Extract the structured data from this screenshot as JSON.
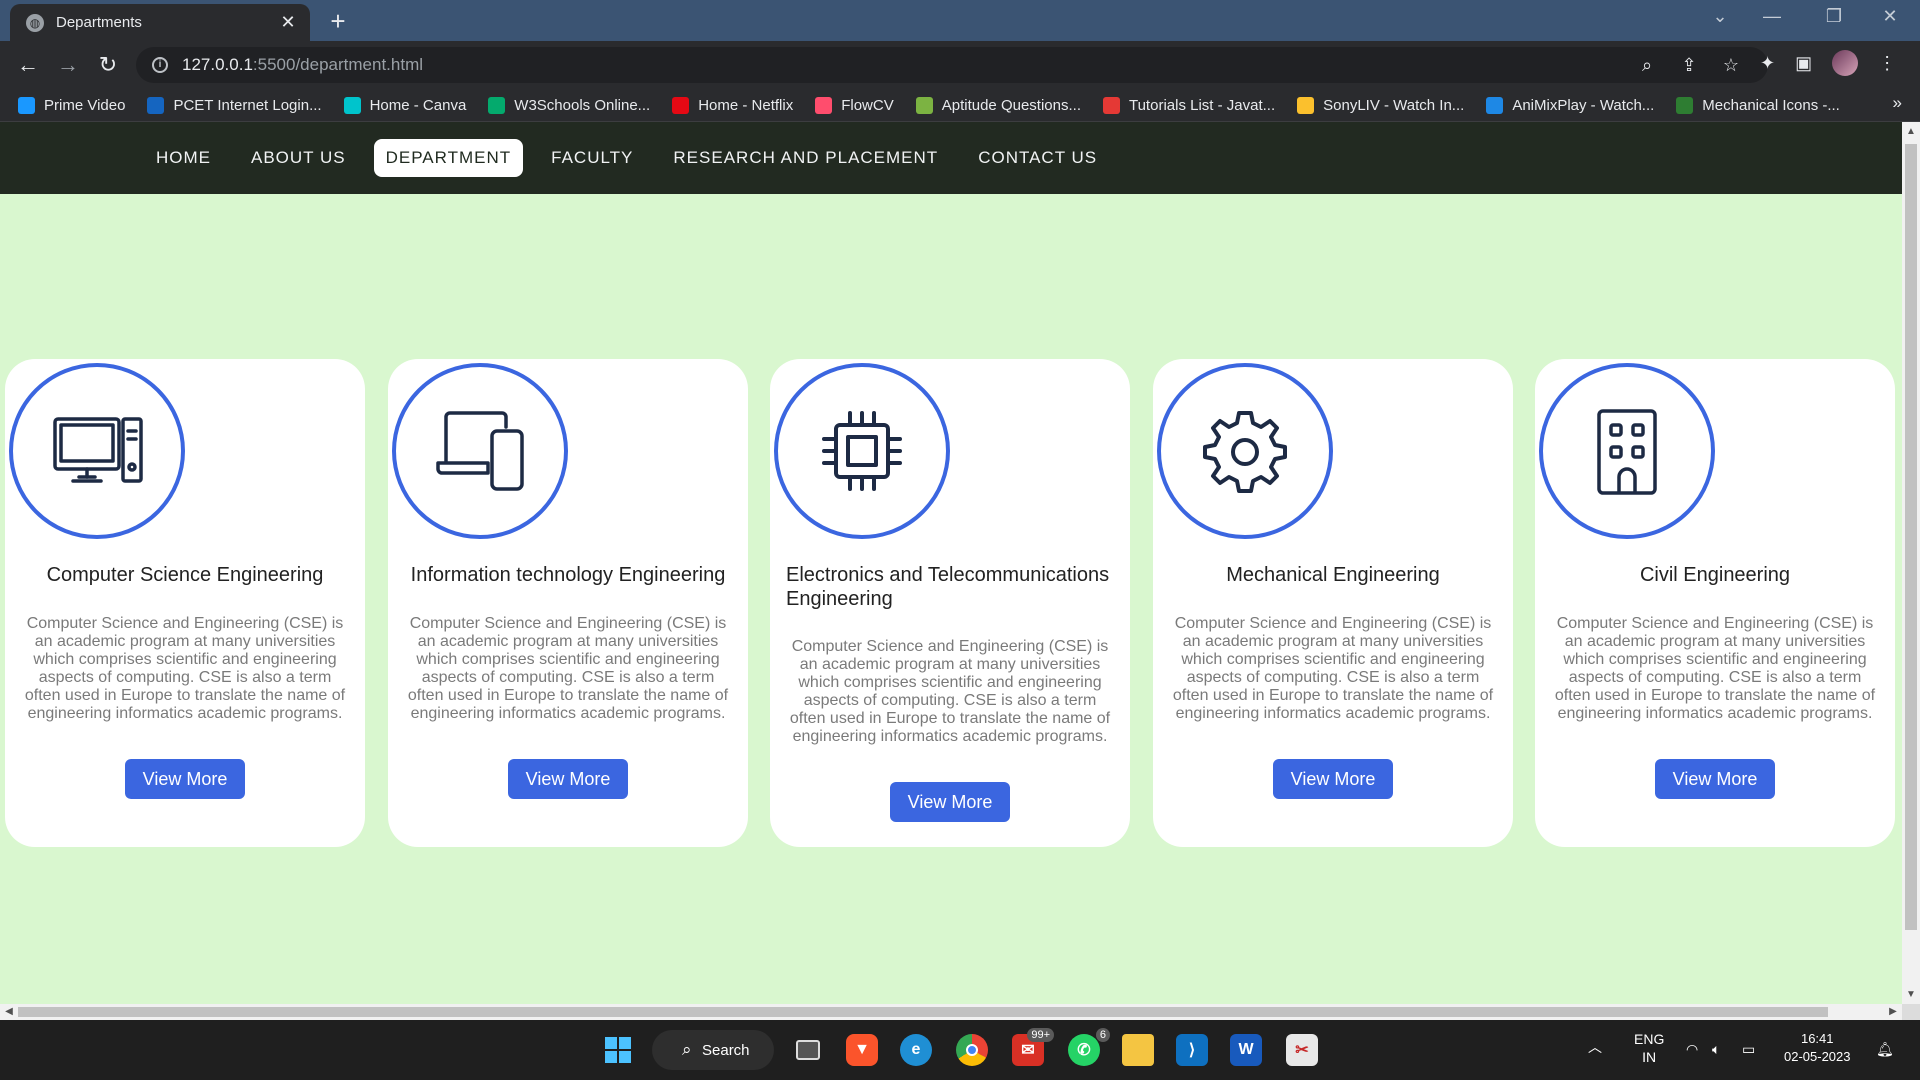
{
  "browser": {
    "tab_title": "Departments",
    "url_host": "127.0.0.1",
    "url_path": ":5500/department.html",
    "bookmarks": [
      {
        "label": "Prime Video",
        "color": "#1a98ff"
      },
      {
        "label": "PCET Internet Login...",
        "color": "#1565c0"
      },
      {
        "label": "Home - Canva",
        "color": "#00c4cc"
      },
      {
        "label": "W3Schools Online...",
        "color": "#04aa6d"
      },
      {
        "label": "Home - Netflix",
        "color": "#e50914"
      },
      {
        "label": "FlowCV",
        "color": "#ff4d6d"
      },
      {
        "label": "Aptitude Questions...",
        "color": "#7cb342"
      },
      {
        "label": "Tutorials List - Javat...",
        "color": "#e53935"
      },
      {
        "label": "SonyLIV - Watch In...",
        "color": "#fbc02d"
      },
      {
        "label": "AniMixPlay - Watch...",
        "color": "#1e88e5"
      },
      {
        "label": "Mechanical Icons -...",
        "color": "#2e7d32"
      }
    ]
  },
  "nav": {
    "items": [
      "HOME",
      "ABOUT US",
      "DEPARTMENT",
      "FACULTY",
      "RESEARCH AND PLACEMENT",
      "CONTACT US"
    ],
    "active": "DEPARTMENT"
  },
  "departments": [
    {
      "title": "Computer Science Engineering",
      "icon": "desktop-computer-icon",
      "description": "Computer Science and Engineering (CSE) is an academic program at many universities which comprises scientific and engineering aspects of computing. CSE is also a term often used in Europe to translate the name of engineering informatics academic programs.",
      "button": "View More"
    },
    {
      "title": "Information technology Engineering",
      "icon": "laptop-phone-icon",
      "description": "Computer Science and Engineering (CSE) is an academic program at many universities which comprises scientific and engineering aspects of computing. CSE is also a term often used in Europe to translate the name of engineering informatics academic programs.",
      "button": "View More"
    },
    {
      "title": "Electronics and Telecommunications Engineering",
      "icon": "microchip-icon",
      "description": "Computer Science and Engineering (CSE) is an academic program at many universities which comprises scientific and engineering aspects of computing. CSE is also a term often used in Europe to translate the name of engineering informatics academic programs.",
      "button": "View More"
    },
    {
      "title": "Mechanical Engineering",
      "icon": "gear-icon",
      "description": "Computer Science and Engineering (CSE) is an academic program at many universities which comprises scientific and engineering aspects of computing. CSE is also a term often used in Europe to translate the name of engineering informatics academic programs.",
      "button": "View More"
    },
    {
      "title": "Civil Engineering",
      "icon": "building-icon",
      "description": "Computer Science and Engineering (CSE) is an academic program at many universities which comprises scientific and engineering aspects of computing. CSE is also a term often used in Europe to translate the name of engineering informatics academic programs.",
      "button": "View More"
    }
  ],
  "colors": {
    "page_bg": "#d9f7cf",
    "navbar_bg": "#222a21",
    "accent": "#3b66e0"
  },
  "taskbar": {
    "search_label": "Search",
    "mail_badge": "99+",
    "whatsapp_badge": "6",
    "language": "ENG",
    "region": "IN",
    "time": "16:41",
    "date": "02-05-2023"
  }
}
